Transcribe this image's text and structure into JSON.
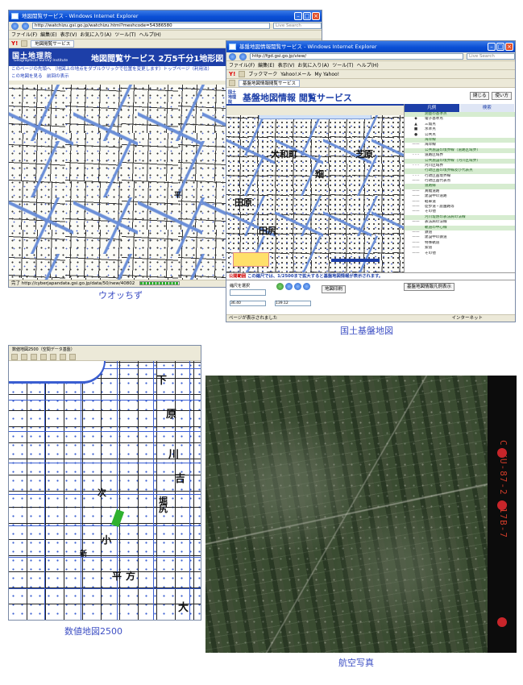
{
  "watchizu": {
    "window_title": "地図閲覧サービス - Windows Internet Explorer",
    "address": "http://watchizu.gsi.go.jp/watchizu.html?meshcode=54386580",
    "search_placeholder": "Live Search",
    "menu": [
      "ファイル(F)",
      "編集(E)",
      "表示(V)",
      "お気に入り(A)",
      "ツール(T)",
      "ヘルプ(H)"
    ],
    "tab": "地図閲覧サービス",
    "logo": "国土地理院",
    "logo_en": "Geographical Survey Institute",
    "service_title": "地図閲覧サービス 2万5千分1地形図",
    "links_line": "このページの先頭へ",
    "links_note": "（地図上の地点をダブルクリックで位置を変更します）トップページ（利用法）",
    "links2": "この地図を見る　前回の表示",
    "status": "完了  http://cyberjapandata.gsi.go.jp/data/50/new/40802"
  },
  "kiban": {
    "window_title": "基盤地図情報閲覧サービス - Windows Internet Explorer",
    "address": "http://fgd.gsi.go.jp/view/",
    "search_placeholder": "Live Search",
    "menu": [
      "ファイル(F)",
      "編集(E)",
      "表示(V)",
      "お気に入り(A)",
      "ツール(T)",
      "ヘルプ(H)"
    ],
    "tab": "基盤地図情報閲覧サービス",
    "fav_links": [
      "ブックマーク",
      "Yahoo!メール",
      "My Yahoo!"
    ],
    "header_pre": "国土地理院",
    "header_title": "基盤地図情報 閲覧サービス",
    "header_buttons": [
      "閉じる",
      "使い方"
    ],
    "legend_tabs": [
      "凡例",
      "検索"
    ],
    "legend_rows": [
      {
        "sym": "",
        "text": "測量の基準点",
        "sec": true
      },
      {
        "sym": "◆",
        "text": "電子基準点"
      },
      {
        "sym": "▲",
        "text": "三角点"
      },
      {
        "sym": "■",
        "text": "水準点"
      },
      {
        "sym": "●",
        "text": "公共点"
      },
      {
        "sym": "",
        "text": "海岸線",
        "sec": true
      },
      {
        "sym": "——",
        "text": "海岸線"
      },
      {
        "sym": "",
        "text": "公共施設の境界線（道路区域界）",
        "sec": true
      },
      {
        "sym": "- - -",
        "text": "道路区域界"
      },
      {
        "sym": "",
        "text": "公共施設の境界線（河川区域界）",
        "sec": true
      },
      {
        "sym": "- - -",
        "text": "河川区域界"
      },
      {
        "sym": "",
        "text": "行政区画の境界線及び代表点",
        "sec": true
      },
      {
        "sym": "- - -",
        "text": "行政区画境界線"
      },
      {
        "sym": "——",
        "text": "行政区画代表点"
      },
      {
        "sym": "",
        "text": "道路縁",
        "sec": true
      },
      {
        "sym": "——",
        "text": "真幅道路"
      },
      {
        "sym": "——",
        "text": "建設中の道路"
      },
      {
        "sym": "——",
        "text": "軽車道"
      },
      {
        "sym": "——",
        "text": "徒歩道・庭園路等"
      },
      {
        "sym": "——",
        "text": "その他"
      },
      {
        "sym": "",
        "text": "河川堤防の表法肩の法線",
        "sec": true
      },
      {
        "sym": "——",
        "text": "表法肩の法線"
      },
      {
        "sym": "",
        "text": "軌道の中心線",
        "sec": true
      },
      {
        "sym": "——",
        "text": "鉄道"
      },
      {
        "sym": "——",
        "text": "建設中の鉄道"
      },
      {
        "sym": "——",
        "text": "特殊軌道"
      },
      {
        "sym": "——",
        "text": "索道"
      },
      {
        "sym": "——",
        "text": "その他"
      }
    ],
    "scale_note": "公開範囲",
    "scale_note_text": "この縮尺では、1/2500まで拡大すると基盤地図情報が表示されます。",
    "map_labels": [
      "大和町",
      "芝原",
      "田原",
      "田尻",
      "畑"
    ],
    "bottom_select": "縮尺を選択",
    "bottom_btn": "地図印刷",
    "coord_lat": "36.40",
    "coord_lon": "139.12",
    "legend_btn": "基盤地図情報凡例表示",
    "status": "ページが表示されました",
    "status_zone": "インターネット"
  },
  "suchi": {
    "window_title": "数値地図2500（空間データ基盤）",
    "labels": [
      "下",
      "原",
      "川",
      "吉",
      "小",
      "大",
      "次",
      "平",
      "方",
      "新",
      "堀",
      "尻"
    ]
  },
  "aerial": {
    "film_text": "C KU-87-2  C17B-7"
  },
  "captions": {
    "watchizu": "ウオッちず",
    "kiban": "国土基盤地図",
    "suchi": "数値地図2500",
    "aerial": "航空写真"
  }
}
